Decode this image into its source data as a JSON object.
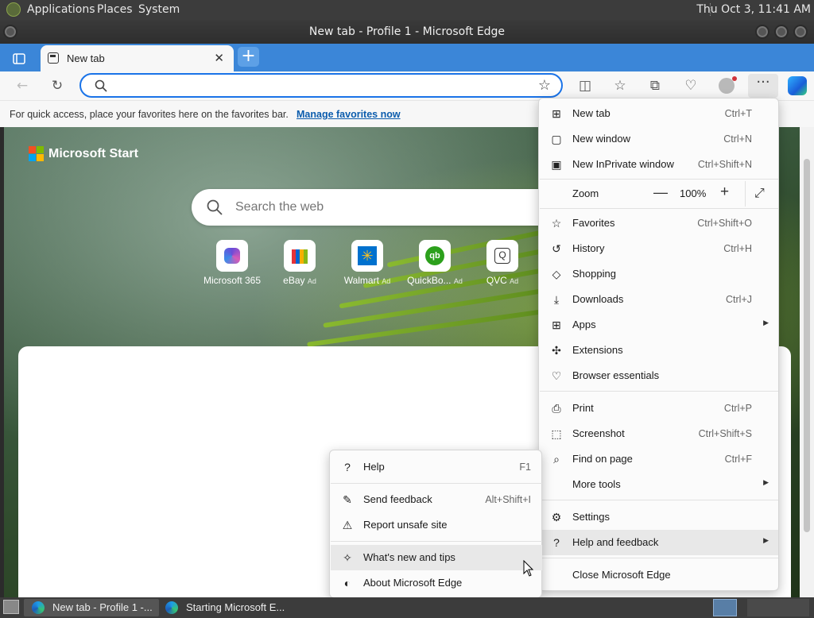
{
  "top_panel": {
    "menus": [
      "Applications",
      "Places",
      "System"
    ],
    "clock": "Thu Oct  3, 11:41 AM"
  },
  "window": {
    "title": "New tab - Profile 1 - Microsoft Edge"
  },
  "tabs": [
    {
      "label": "New tab"
    }
  ],
  "address_bar": {
    "value": "",
    "placeholder": ""
  },
  "favorites_bar": {
    "text": "For quick access, place your favorites here on the favorites bar.",
    "link": "Manage favorites now"
  },
  "page": {
    "brand": "Microsoft Start",
    "search_placeholder": "Search the web",
    "quick_links": [
      {
        "label": "Microsoft 365",
        "ad": ""
      },
      {
        "label": "eBay",
        "ad": "Ad"
      },
      {
        "label": "Walmart",
        "ad": "Ad"
      },
      {
        "label": "QuickBo...",
        "ad": "Ad"
      },
      {
        "label": "QVC",
        "ad": "Ad"
      }
    ]
  },
  "menu": {
    "items": [
      {
        "label": "New tab",
        "shortcut": "Ctrl+T",
        "icon": "new-tab-icon"
      },
      {
        "label": "New window",
        "shortcut": "Ctrl+N",
        "icon": "new-window-icon"
      },
      {
        "label": "New InPrivate window",
        "shortcut": "Ctrl+Shift+N",
        "icon": "inprivate-icon"
      },
      {
        "label": "Favorites",
        "shortcut": "Ctrl+Shift+O",
        "icon": "favorites-icon"
      },
      {
        "label": "History",
        "shortcut": "Ctrl+H",
        "icon": "history-icon"
      },
      {
        "label": "Shopping",
        "shortcut": "",
        "icon": "shopping-icon"
      },
      {
        "label": "Downloads",
        "shortcut": "Ctrl+J",
        "icon": "download-icon"
      },
      {
        "label": "Apps",
        "shortcut": "",
        "icon": "apps-icon"
      },
      {
        "label": "Extensions",
        "shortcut": "",
        "icon": "extensions-icon"
      },
      {
        "label": "Browser essentials",
        "shortcut": "",
        "icon": "heart-pulse-icon"
      },
      {
        "label": "Print",
        "shortcut": "Ctrl+P",
        "icon": "print-icon"
      },
      {
        "label": "Screenshot",
        "shortcut": "Ctrl+Shift+S",
        "icon": "screenshot-icon"
      },
      {
        "label": "Find on page",
        "shortcut": "Ctrl+F",
        "icon": "find-icon"
      },
      {
        "label": "More tools",
        "shortcut": "",
        "icon": ""
      },
      {
        "label": "Settings",
        "shortcut": "",
        "icon": "gear-icon"
      },
      {
        "label": "Help and feedback",
        "shortcut": "",
        "icon": "help-icon"
      },
      {
        "label": "Close Microsoft Edge",
        "shortcut": "",
        "icon": ""
      }
    ],
    "zoom": {
      "label": "Zoom",
      "value": "100%"
    }
  },
  "submenu": {
    "items": [
      {
        "label": "Help",
        "shortcut": "F1",
        "icon": "help-icon"
      },
      {
        "label": "Send feedback",
        "shortcut": "Alt+Shift+I",
        "icon": "feedback-icon"
      },
      {
        "label": "Report unsafe site",
        "shortcut": "",
        "icon": "warning-icon"
      },
      {
        "label": "What's new and tips",
        "shortcut": "",
        "icon": "tips-icon"
      },
      {
        "label": "About Microsoft Edge",
        "shortcut": "",
        "icon": "edge-logo-icon"
      }
    ]
  },
  "taskbar": {
    "tasks": [
      "New tab - Profile 1 -...",
      "Starting Microsoft E..."
    ]
  }
}
